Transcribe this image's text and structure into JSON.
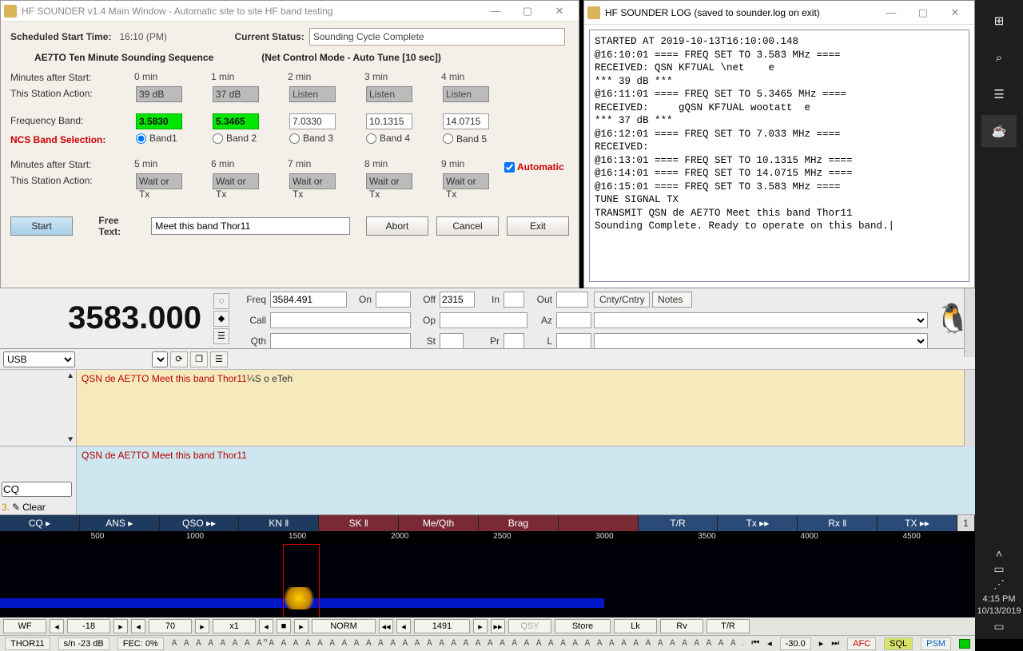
{
  "main": {
    "title": "HF SOUNDER v1.4 Main Window - Automatic site to site HF band testing",
    "sched_label": "Scheduled Start Time:",
    "sched_value": "16:10 (PM)",
    "status_label": "Current Status:",
    "status_value": "Sounding Cycle Complete",
    "seq_title": "AE7TO  Ten Minute Sounding Sequence",
    "mode_title": "(Net Control Mode - Auto Tune [10 sec])",
    "labels": {
      "min_after": "Minutes after Start:",
      "action": "This Station Action:",
      "freq": "Frequency Band:",
      "ncs": "NCS Band Selection:"
    },
    "cols1": [
      "0 min",
      "1 min",
      "2 min",
      "3 min",
      "4 min"
    ],
    "actions1": [
      "39 dB",
      "37 dB",
      "Listen",
      "Listen",
      "Listen"
    ],
    "freqs": [
      "3.5830",
      "5.3465",
      "7.0330",
      "10.1315",
      "14.0715"
    ],
    "bands": [
      "Band1",
      "Band 2",
      "Band 3",
      "Band 4",
      "Band 5"
    ],
    "auto": "Automatic",
    "cols2": [
      "5 min",
      "6 min",
      "7 min",
      "8 min",
      "9 min"
    ],
    "actions2": [
      "Wait or Tx",
      "Wait or Tx",
      "Wait or Tx",
      "Wait or Tx",
      "Wait or Tx"
    ],
    "buttons": {
      "start": "Start",
      "abort": "Abort",
      "cancel": "Cancel",
      "exit": "Exit"
    },
    "freetext_label": "Free Text:",
    "freetext_value": "Meet this band Thor11"
  },
  "log": {
    "title": "HF SOUNDER LOG (saved to sounder.log on exit)",
    "text": "STARTED AT 2019-10-13T16:10:00.148\n@16:10:01 ==== FREQ SET TO 3.583 MHz ====\nRECEIVED: QSN KF7UAL \\net    e\n*** 39 dB ***\n@16:11:01 ==== FREQ SET TO 5.3465 MHz ====\nRECEIVED:     gQSN KF7UAL wootatt  e\n*** 37 dB ***\n@16:12:01 ==== FREQ SET TO 7.033 MHz ====\nRECEIVED:\n@16:13:01 ==== FREQ SET TO 10.1315 MHz ====\n@16:14:01 ==== FREQ SET TO 14.0715 MHz ====\n@16:15:01 ==== FREQ SET TO 3.583 MHz ====\nTUNE SIGNAL TX\nTRANSMIT QSN de AE7TO Meet this band Thor11\nSounding Complete. Ready to operate on this band.|"
  },
  "fldigi": {
    "freq": "3583.000",
    "mode": "USB",
    "fields": {
      "freq_l": "Freq",
      "freq_v": "3584.491",
      "on_l": "On",
      "on_v": "",
      "off_l": "Off",
      "off_v": "2315",
      "in_l": "In",
      "out_l": "Out",
      "cnty_l": "Cnty/Cntry",
      "notes_l": "Notes",
      "call_l": "Call",
      "op_l": "Op",
      "az_l": "Az",
      "qth_l": "Qth",
      "st_l": "St",
      "pr_l": "Pr",
      "loc_l": "L"
    },
    "rx_text": "QSN de AE7TO Meet this band Thor11",
    "rx_suffix": "¼S o eTeh",
    "tx_text": "QSN de AE7TO Meet this band Thor11",
    "cq": "CQ",
    "clear": "Clear",
    "macros": [
      "CQ ▸",
      "ANS ▸",
      "QSO ▸▸",
      "KN ‖",
      "SK ‖",
      "Me/Qth",
      "Brag",
      "T/R",
      "Tx ▸▸",
      "Rx ‖",
      "TX ▸▸"
    ],
    "wf_marks": [
      "500",
      "1000",
      "1500",
      "2000",
      "2500",
      "3000",
      "3500",
      "4000",
      "4500"
    ],
    "wf_positions": [
      10,
      20,
      30.5,
      41,
      51.5,
      62,
      72.5,
      83,
      93.5
    ],
    "wf_ctrl": {
      "wf": "WF",
      "a1": "-18",
      "a2": "70",
      "zoom": "x1",
      "mode": "NORM",
      "cursor": "1491",
      "qsy": "QSY",
      "store": "Store",
      "lk": "Lk",
      "rv": "Rv",
      "tr": "T/R"
    },
    "status": {
      "mode": "THOR11",
      "sn": "s/n -23 dB",
      "fec": "FEC:    0%",
      "letters": "A A A A A A A A\"A A A A A A A A A A A A A A A A A A A A A A A A A A A A A A A A A A A A A A A A A A A A A",
      "val": "-30.0",
      "afc": "AFC",
      "sql": "SQL",
      "psm": "PSM"
    }
  },
  "tray": {
    "time": "4:15 PM",
    "date": "10/13/2019"
  }
}
